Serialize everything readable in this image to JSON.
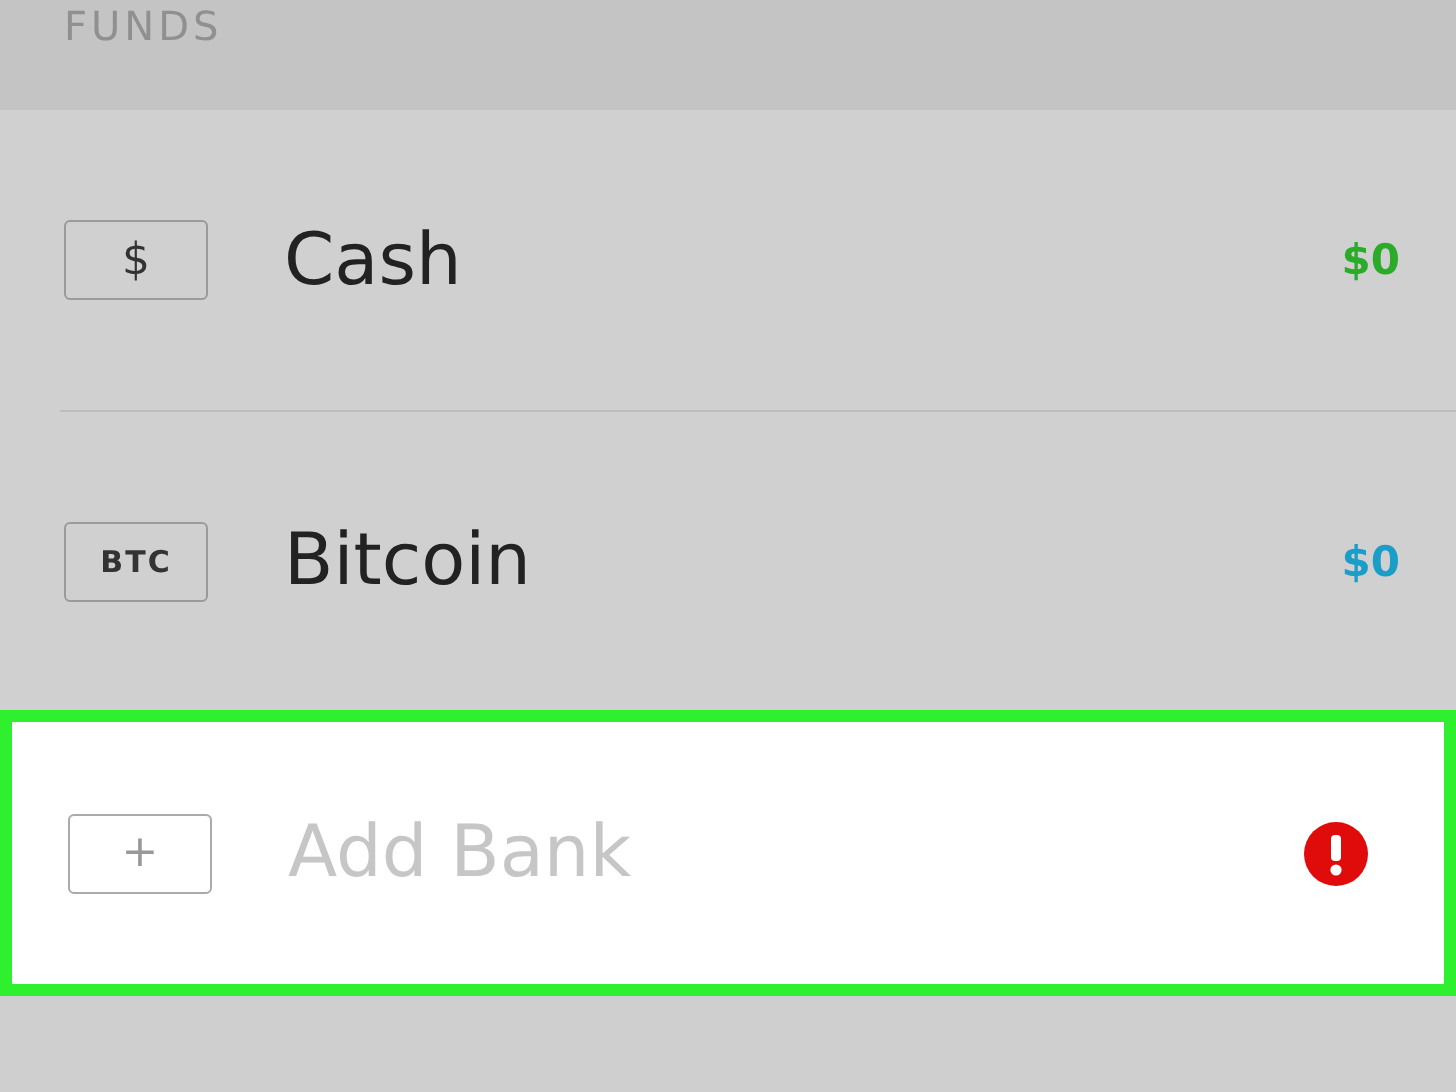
{
  "section": {
    "title": "FUNDS"
  },
  "rows": [
    {
      "icon_label": "$",
      "name": "Cash",
      "amount": "$0",
      "color": "#2aab2a",
      "highlighted": false,
      "alert": false,
      "disabled": false
    },
    {
      "icon_label": "BTC",
      "name": "Bitcoin",
      "amount": "$0",
      "color": "#1a9ec8",
      "highlighted": false,
      "alert": false,
      "disabled": false
    },
    {
      "icon_label": "+",
      "name": "Add Bank",
      "highlighted": true,
      "alert": true,
      "disabled": true
    }
  ]
}
